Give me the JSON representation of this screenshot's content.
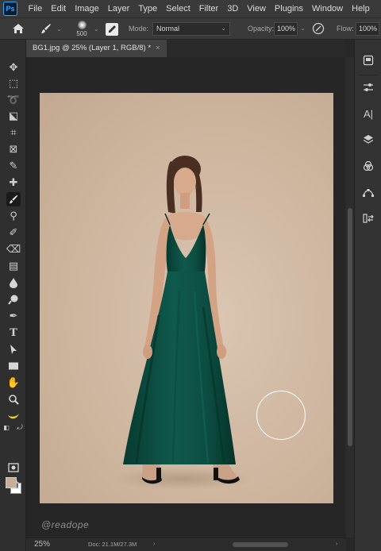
{
  "app": {
    "logo_text": "Ps",
    "menu": [
      "File",
      "Edit",
      "Image",
      "Layer",
      "Type",
      "Select",
      "Filter",
      "3D",
      "View",
      "Plugins",
      "Window",
      "Help"
    ]
  },
  "options": {
    "brush_size": "500",
    "mode_label": "Mode:",
    "mode_value": "Normal",
    "opacity_label": "Opacity:",
    "opacity_value": "100%",
    "flow_label": "Flow:",
    "flow_value": "100%"
  },
  "document": {
    "tab_title": "BG1.jpg @ 25% (Layer 1, RGB/8) *",
    "close_glyph": "×"
  },
  "status": {
    "zoom": "25%",
    "doc_info": "Doc: 21.1M/27.3M",
    "arrow": "›"
  },
  "watermark": "@readope",
  "colors": {
    "foreground": "#c5ad96",
    "background": "#ffffff",
    "dress": "#0f5a4c"
  },
  "tools": [
    {
      "name": "move-tool-icon",
      "glyph": "✥"
    },
    {
      "name": "marquee-tool-icon",
      "glyph": "⬚"
    },
    {
      "name": "lasso-tool-icon",
      "glyph": "➰"
    },
    {
      "name": "object-select-tool-icon",
      "glyph": "⬕"
    },
    {
      "name": "crop-tool-icon",
      "glyph": "⌗"
    },
    {
      "name": "frame-tool-icon",
      "glyph": "⊠"
    },
    {
      "name": "eyedropper-tool-icon",
      "glyph": "✎"
    },
    {
      "name": "healing-brush-tool-icon",
      "glyph": "✚"
    },
    {
      "name": "brush-tool-icon",
      "glyph": "🖌"
    },
    {
      "name": "clone-stamp-tool-icon",
      "glyph": "⚲"
    },
    {
      "name": "history-brush-tool-icon",
      "glyph": "✐"
    },
    {
      "name": "eraser-tool-icon",
      "glyph": "⌫"
    },
    {
      "name": "gradient-tool-icon",
      "glyph": "▤"
    },
    {
      "name": "blur-tool-icon",
      "glyph": "💧"
    },
    {
      "name": "dodge-tool-icon",
      "glyph": "●"
    },
    {
      "name": "pen-tool-icon",
      "glyph": "✒"
    },
    {
      "name": "type-tool-icon",
      "glyph": "T"
    },
    {
      "name": "path-select-tool-icon",
      "glyph": "➤"
    },
    {
      "name": "rectangle-tool-icon",
      "glyph": "▭"
    },
    {
      "name": "hand-tool-icon",
      "glyph": "✋"
    },
    {
      "name": "zoom-tool-icon",
      "glyph": "🔍"
    },
    {
      "name": "banana-icon",
      "glyph": "🍌"
    }
  ],
  "right_panel": [
    {
      "name": "libraries-icon",
      "glyph": "▣"
    },
    {
      "name": "adjustments-icon",
      "glyph": "⚌"
    },
    {
      "name": "character-icon",
      "glyph": "A|"
    },
    {
      "name": "layers-icon",
      "glyph": "◈"
    },
    {
      "name": "channels-icon",
      "glyph": "◍"
    },
    {
      "name": "paths-icon",
      "glyph": "⌁"
    },
    {
      "name": "history-icon",
      "glyph": "⇄"
    }
  ]
}
